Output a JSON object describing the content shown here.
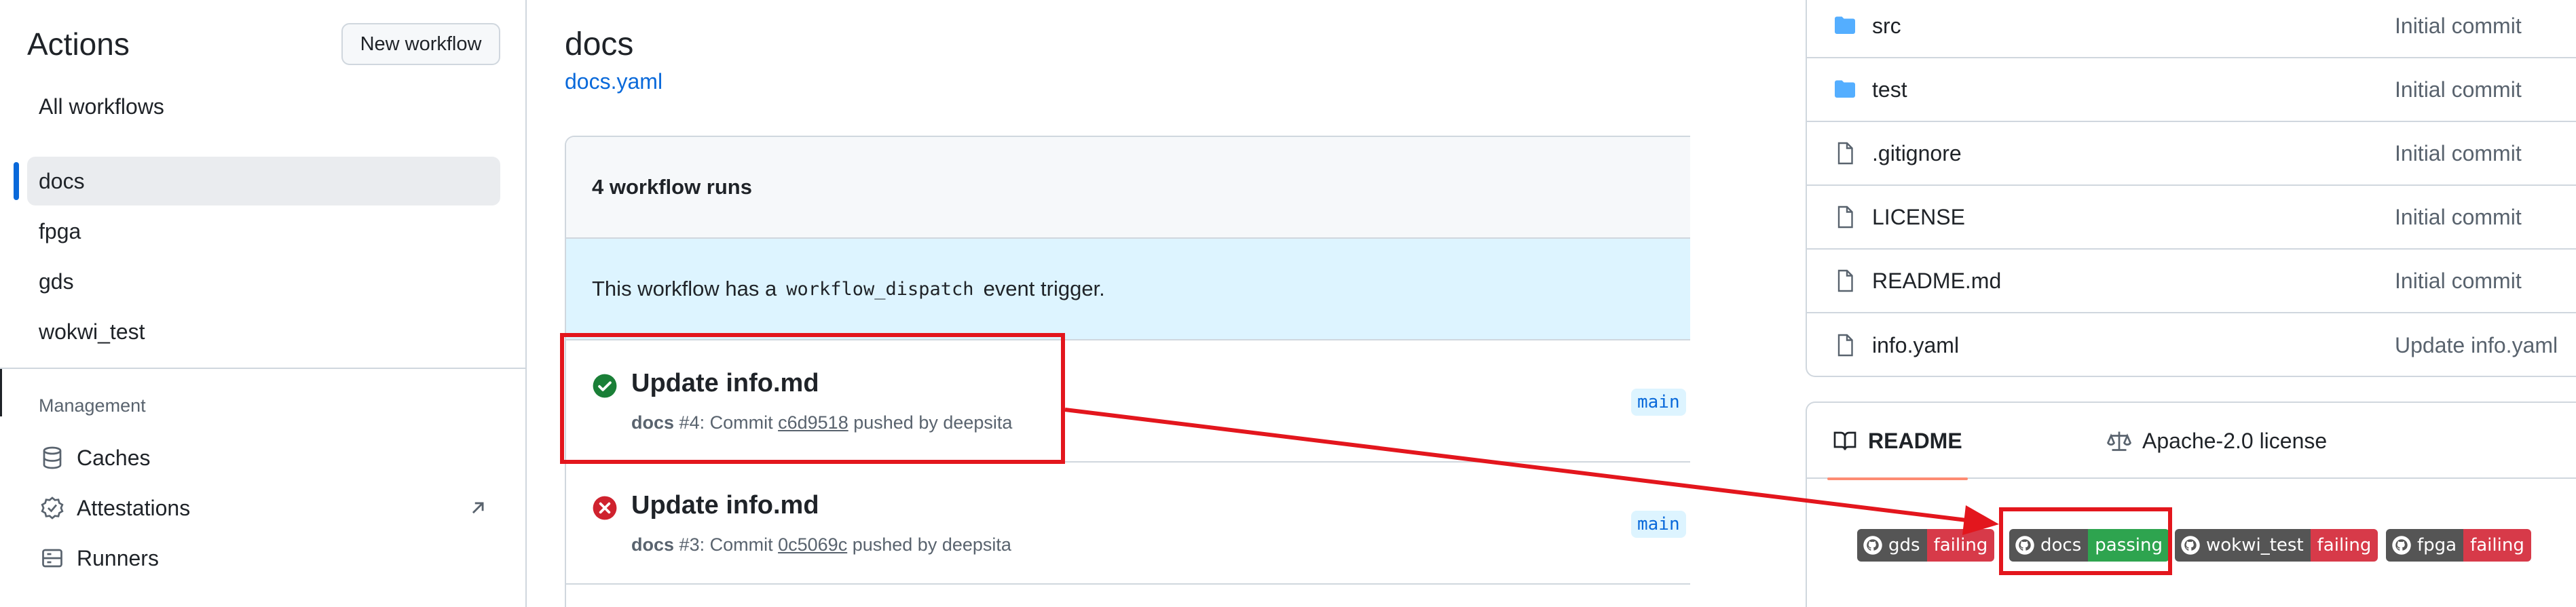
{
  "sidebar": {
    "title": "Actions",
    "new_workflow_label": "New workflow",
    "all_workflows_label": "All workflows",
    "workflows": [
      {
        "label": "docs",
        "active": true
      },
      {
        "label": "fpga",
        "active": false
      },
      {
        "label": "gds",
        "active": false
      },
      {
        "label": "wokwi_test",
        "active": false
      }
    ],
    "management_label": "Management",
    "management": [
      {
        "label": "Caches",
        "icon": "database-icon"
      },
      {
        "label": "Attestations",
        "icon": "verified-icon"
      },
      {
        "label": "Runners",
        "icon": "server-icon"
      }
    ]
  },
  "main": {
    "workflow_title": "docs",
    "workflow_file": "docs.yaml",
    "runs_count_label": "4 workflow runs",
    "dispatch_prefix": "This workflow has a",
    "dispatch_code": "workflow_dispatch",
    "dispatch_suffix": "event trigger.",
    "runs": [
      {
        "title": "Update info.md",
        "status": "success",
        "workflow": "docs",
        "number": "#4",
        "commit_prefix": ": Commit",
        "sha": "c6d9518",
        "pushed_by": "pushed by deepsita",
        "branch": "main"
      },
      {
        "title": "Update info.md",
        "status": "failure",
        "workflow": "docs",
        "number": "#3",
        "commit_prefix": ": Commit",
        "sha": "0c5069c",
        "pushed_by": "pushed by deepsita",
        "branch": "main"
      }
    ]
  },
  "repo": {
    "files": [
      {
        "name": "src",
        "type": "folder",
        "message": "Initial commit"
      },
      {
        "name": "test",
        "type": "folder",
        "message": "Initial commit"
      },
      {
        "name": ".gitignore",
        "type": "file",
        "message": "Initial commit"
      },
      {
        "name": "LICENSE",
        "type": "file",
        "message": "Initial commit"
      },
      {
        "name": "README.md",
        "type": "file",
        "message": "Initial commit"
      },
      {
        "name": "info.yaml",
        "type": "file",
        "message": "Update info.yaml"
      }
    ],
    "readme_tab": "README",
    "license_tab": "Apache-2.0 license",
    "badges": [
      {
        "label": "gds",
        "status": "failing"
      },
      {
        "label": "docs",
        "status": "passing"
      },
      {
        "label": "wokwi_test",
        "status": "failing"
      },
      {
        "label": "fpga",
        "status": "failing"
      }
    ]
  },
  "colors": {
    "accent": "#0969da",
    "success": "#1a7f37",
    "failure": "#cf222e",
    "annotation": "#e3161d",
    "badge_failing": "#d73a49",
    "badge_passing": "#2ea44f"
  }
}
